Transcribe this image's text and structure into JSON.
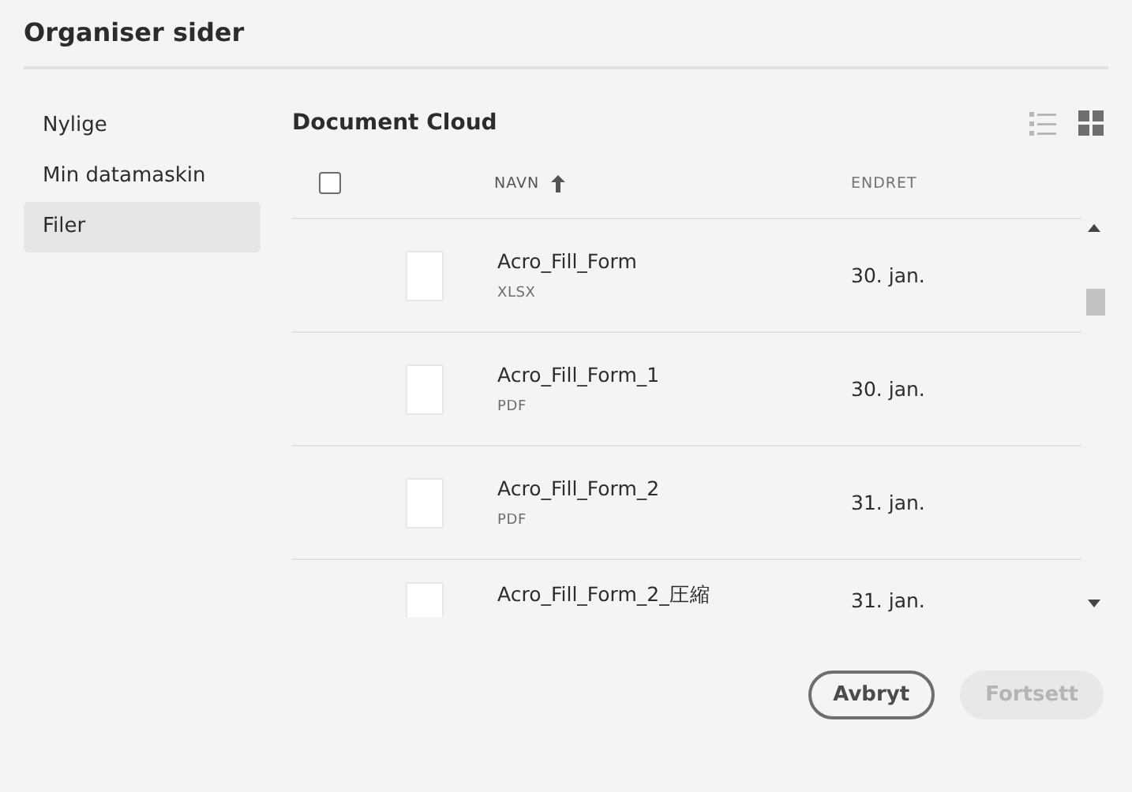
{
  "dialog": {
    "title": "Organiser sider"
  },
  "sidebar": {
    "items": [
      {
        "label": "Nylige",
        "selected": false
      },
      {
        "label": "Min datamaskin",
        "selected": false
      },
      {
        "label": "Filer",
        "selected": true
      }
    ]
  },
  "main": {
    "title": "Document Cloud",
    "view_options": [
      {
        "kind": "list",
        "selected": false
      },
      {
        "kind": "grid",
        "selected": true
      }
    ],
    "table": {
      "select_all_checked": false,
      "columns": [
        {
          "label": "NAVN",
          "sorted": true
        },
        {
          "label": "ENDRET",
          "sorted": false
        }
      ],
      "rows": [
        {
          "name": "Acro_Fill_Form",
          "type": "XLSX",
          "modified": "30. jan."
        },
        {
          "name": "Acro_Fill_Form_1",
          "type": "PDF",
          "modified": "30. jan."
        },
        {
          "name": "Acro_Fill_Form_2",
          "type": "PDF",
          "modified": "31. jan."
        },
        {
          "name": "Acro_Fill_Form_2_圧縮",
          "modified": "31. jan."
        }
      ]
    }
  },
  "buttons": [
    {
      "label": "Avbryt",
      "disabled": false
    },
    {
      "label": "Fortsett",
      "disabled": true
    }
  ]
}
